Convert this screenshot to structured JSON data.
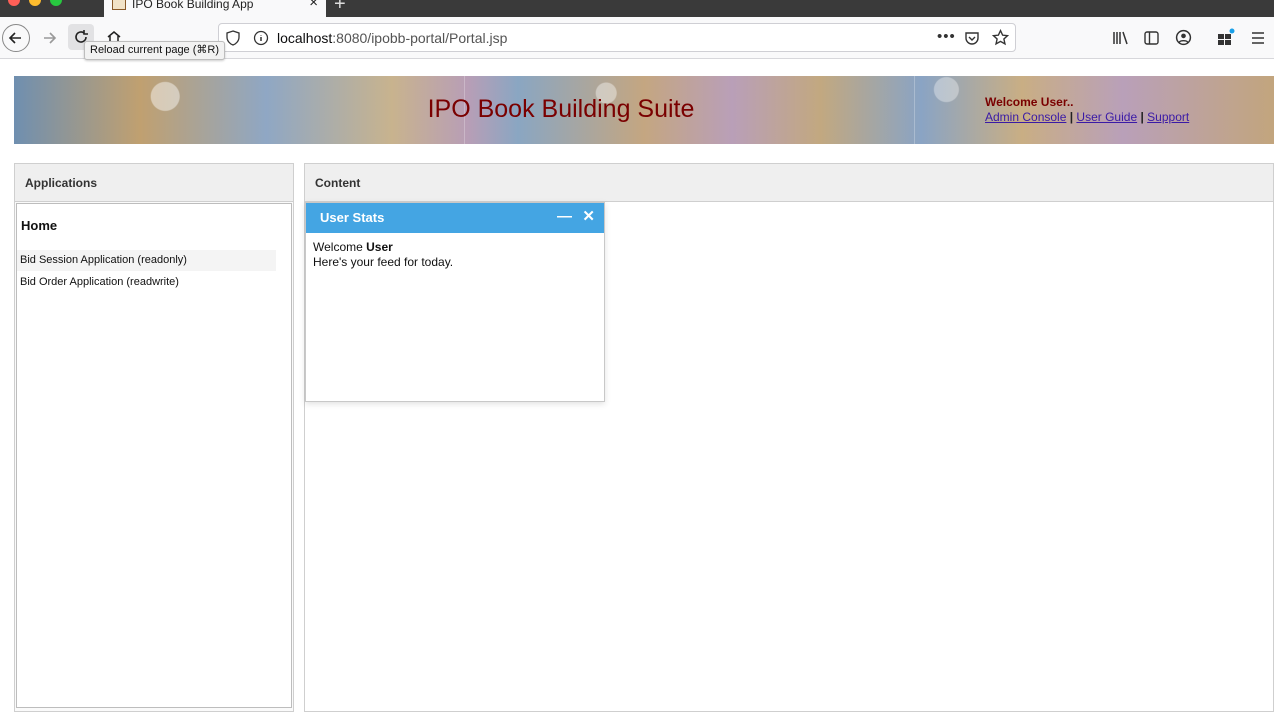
{
  "browser": {
    "tab_title": "IPO Book Building App",
    "new_tab_label": "+",
    "url_host": "localhost",
    "url_path": ":8080/ipobb-portal/Portal.jsp",
    "tooltip": "Reload current page (⌘R)"
  },
  "banner": {
    "title": "IPO Book Building Suite",
    "welcome": "Welcome User..",
    "links": [
      "Admin Console",
      "User Guide",
      "Support"
    ],
    "separator": "|"
  },
  "sidebar": {
    "header": "Applications",
    "home": "Home",
    "items": [
      {
        "label": "Bid Session Application (readonly)"
      },
      {
        "label": "Bid Order Application (readwrite)"
      }
    ]
  },
  "content": {
    "header": "Content",
    "widget": {
      "title": "User Stats",
      "minimize": "—",
      "close": "✕",
      "welcome_prefix": "Welcome",
      "welcome_user": "User",
      "feed_text": "Here's your feed for today."
    }
  },
  "colors": {
    "banner_title": "#7a0000",
    "link": "#3a1aa6",
    "widget_header": "#44a5e3"
  }
}
